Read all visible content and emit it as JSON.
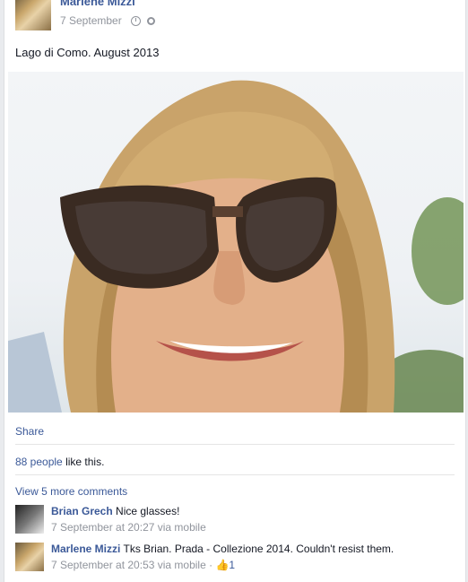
{
  "post": {
    "author": "Marlene Mizzi",
    "date": "7 September",
    "caption": "Lago di Como. August 2013"
  },
  "actions": {
    "share": "Share"
  },
  "likes": {
    "count": "88 people",
    "suffix": "like this."
  },
  "comments_more": "View 5 more comments",
  "comments": [
    {
      "name": "Brian Grech",
      "text": "Nice glasses!",
      "time": "7 September at 20:27 via mobile"
    },
    {
      "name": "Marlene Mizzi",
      "text": "Tks Brian. Prada - Collezione 2014. Couldn't resist them.",
      "time": "7 September at 20:53 via mobile",
      "middot": "·",
      "like_count": "1"
    }
  ],
  "colors": {
    "link": "#3b5998",
    "meta": "#90949c"
  }
}
